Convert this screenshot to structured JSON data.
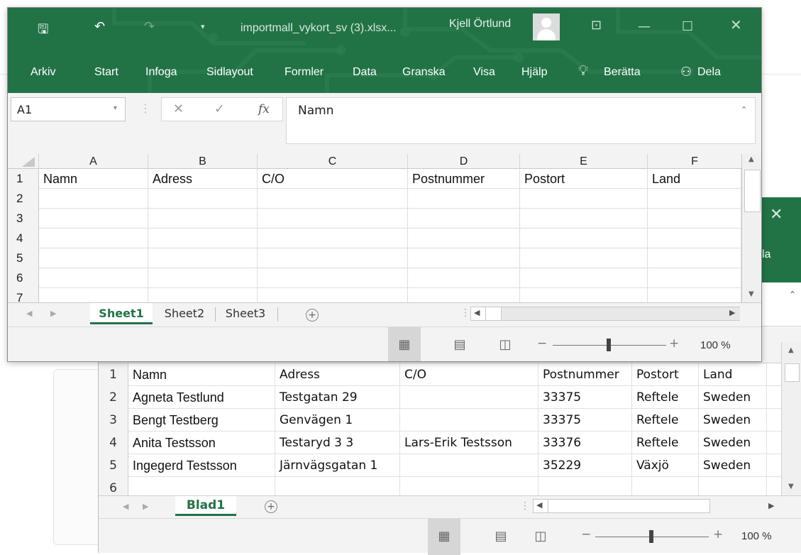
{
  "colors": {
    "excel_green": "#217346",
    "ribbon_text": "#ffffff",
    "grid_line": "#dedede"
  },
  "front": {
    "title": "importmall_vykort_sv (3).xlsx...",
    "user": "Kjell Örtlund",
    "icons": [
      "save-icon",
      "undo-icon",
      "redo-icon",
      "customize-arrow-icon",
      "ribbon-display-icon",
      "minimize-icon",
      "maximize-icon",
      "close-icon"
    ],
    "ribbon_tabs": [
      "Arkiv",
      "Start",
      "Infoga",
      "Sidlayout",
      "Formler",
      "Data",
      "Granska",
      "Visa",
      "Hjälp",
      "Berätta",
      "Dela"
    ],
    "name_box": "A1",
    "formula_value": "Namn",
    "columns": [
      "A",
      "B",
      "C",
      "D",
      "E",
      "F"
    ],
    "rows": [
      {
        "n": "1",
        "cells": [
          "Namn",
          "Adress",
          "C/O",
          "Postnummer",
          "Postort",
          "Land"
        ]
      },
      {
        "n": "2",
        "cells": [
          "",
          "",
          "",
          "",
          "",
          ""
        ]
      },
      {
        "n": "3",
        "cells": [
          "",
          "",
          "",
          "",
          "",
          ""
        ]
      },
      {
        "n": "4",
        "cells": [
          "",
          "",
          "",
          "",
          "",
          ""
        ]
      },
      {
        "n": "5",
        "cells": [
          "",
          "",
          "",
          "",
          "",
          ""
        ]
      },
      {
        "n": "6",
        "cells": [
          "",
          "",
          "",
          "",
          "",
          ""
        ]
      },
      {
        "n": "7",
        "cells": [
          "",
          "",
          "",
          "",
          "",
          ""
        ]
      }
    ],
    "sheets": [
      "Sheet1",
      "Sheet2",
      "Sheet3"
    ],
    "zoom": "100 %"
  },
  "back": {
    "ribbon_fragment": "la",
    "rows": [
      {
        "n": "1",
        "cells": [
          "Namn",
          "Adress",
          "C/O",
          "Postnummer",
          "Postort",
          "Land"
        ]
      },
      {
        "n": "2",
        "cells": [
          "Agneta Testlund",
          "Testgatan 29",
          "",
          "33375",
          "Reftele",
          "Sweden"
        ]
      },
      {
        "n": "3",
        "cells": [
          "Bengt Testberg",
          "Genvägen 1",
          "",
          "33375",
          "Reftele",
          "Sweden"
        ]
      },
      {
        "n": "4",
        "cells": [
          "Anita Testsson",
          "Testaryd 3 3",
          "Lars-Erik Testsson",
          "33376",
          "Reftele",
          "Sweden"
        ]
      },
      {
        "n": "5",
        "cells": [
          "Ingegerd Testsson",
          "Järnvägsgatan 1",
          "",
          "35229",
          "Växjö",
          "Sweden"
        ]
      },
      {
        "n": "6",
        "cells": [
          "",
          "",
          "",
          "",
          "",
          ""
        ]
      }
    ],
    "sheets": [
      "Blad1"
    ],
    "zoom": "100 %"
  }
}
